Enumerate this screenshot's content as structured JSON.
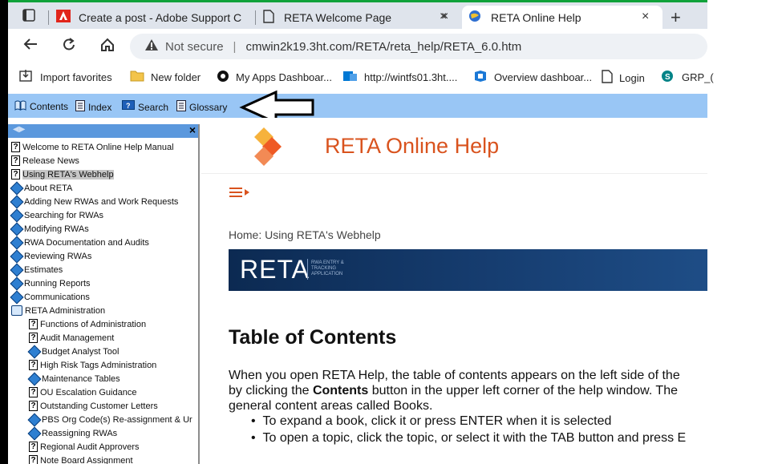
{
  "browser": {
    "tabs": [
      {
        "title": "Create a post - Adobe Support C",
        "close": "×"
      },
      {
        "title": "RETA Welcome Page",
        "close": "×"
      },
      {
        "title": "RETA Online Help",
        "close": "×"
      }
    ],
    "new_tab": "+",
    "address": {
      "security": "Not secure",
      "url": "cmwin2k19.3ht.com/RETA/reta_help/RETA_6.0.htm"
    },
    "bookmarks": [
      {
        "label": "Import favorites",
        "icon": "import-icon"
      },
      {
        "label": "New folder",
        "icon": "folder-icon"
      },
      {
        "label": "My Apps Dashboar...",
        "icon": "office-icon"
      },
      {
        "label": "http://wintfs01.3ht....",
        "icon": "devops-icon"
      },
      {
        "label": "Overview dashboar...",
        "icon": "azure-icon"
      },
      {
        "label": "Login",
        "icon": "page-icon"
      },
      {
        "label": "GRP_(",
        "icon": "sharepoint-icon"
      }
    ]
  },
  "help_toolbar": {
    "contents": "Contents",
    "index": "Index",
    "search": "Search",
    "glossary": "Glossary"
  },
  "toc": {
    "close": "×",
    "items": [
      {
        "label": "Welcome to RETA Online Help Manual",
        "type": "topic",
        "level": 0
      },
      {
        "label": "Release News",
        "type": "topic",
        "level": 0
      },
      {
        "label": "Using RETA's Webhelp",
        "type": "topic",
        "level": 0,
        "selected": true
      },
      {
        "label": "About RETA",
        "type": "book",
        "level": 0
      },
      {
        "label": "Adding New RWAs and Work Requests",
        "type": "book",
        "level": 0
      },
      {
        "label": "Searching for RWAs",
        "type": "book",
        "level": 0
      },
      {
        "label": "Modifying RWAs",
        "type": "book",
        "level": 0
      },
      {
        "label": "RWA Documentation and Audits",
        "type": "book",
        "level": 0
      },
      {
        "label": "Reviewing RWAs",
        "type": "book",
        "level": 0
      },
      {
        "label": "Estimates",
        "type": "book",
        "level": 0
      },
      {
        "label": "Running Reports",
        "type": "book",
        "level": 0
      },
      {
        "label": "Communications",
        "type": "book",
        "level": 0
      },
      {
        "label": "RETA Administration",
        "type": "openbook",
        "level": 0
      },
      {
        "label": "Functions of Administration",
        "type": "topic",
        "level": 1
      },
      {
        "label": "Audit Management",
        "type": "topic",
        "level": 1
      },
      {
        "label": "Budget Analyst Tool",
        "type": "book",
        "level": 1
      },
      {
        "label": "High Risk Tags Administration",
        "type": "topic",
        "level": 1
      },
      {
        "label": "Maintenance Tables",
        "type": "book",
        "level": 1
      },
      {
        "label": "OU Escalation Guidance",
        "type": "topic",
        "level": 1
      },
      {
        "label": "Outstanding Customer Letters",
        "type": "topic",
        "level": 1
      },
      {
        "label": "PBS Org Code(s) Re-assignment & Ur",
        "type": "book",
        "level": 1
      },
      {
        "label": "Reassigning RWAs",
        "type": "book",
        "level": 1
      },
      {
        "label": "Regional Audit Approvers",
        "type": "topic",
        "level": 1
      },
      {
        "label": "Note Board Assignment",
        "type": "topic",
        "level": 1
      }
    ]
  },
  "content": {
    "title": "RETA Online Help",
    "breadcrumb": "Home: Using RETA's Webhelp",
    "banner": {
      "name": "RETA",
      "subtitle": "RWA ENTRY & TRACKING APPLICATION"
    },
    "heading": "Table of Contents",
    "paragraph_lines": [
      {
        "pre": "When you open RETA Help, the table of contents appears on the left side of the",
        "bold": "",
        "post": ""
      },
      {
        "pre": "by clicking the ",
        "bold": "Contents",
        "post": " button in the upper left corner of the help window. The"
      },
      {
        "pre": "general content areas called Books.",
        "bold": "",
        "post": ""
      }
    ],
    "bullets": [
      "To expand a book, click it or press ENTER when it is selected",
      "To open a topic, click the topic, or select it with the TAB button and press E"
    ]
  },
  "colors": {
    "accent_orange": "#d9531e",
    "toolbar_blue": "#99c6f5",
    "toc_header_blue": "#5b98dd",
    "banner_navy": "#0c2a52"
  }
}
